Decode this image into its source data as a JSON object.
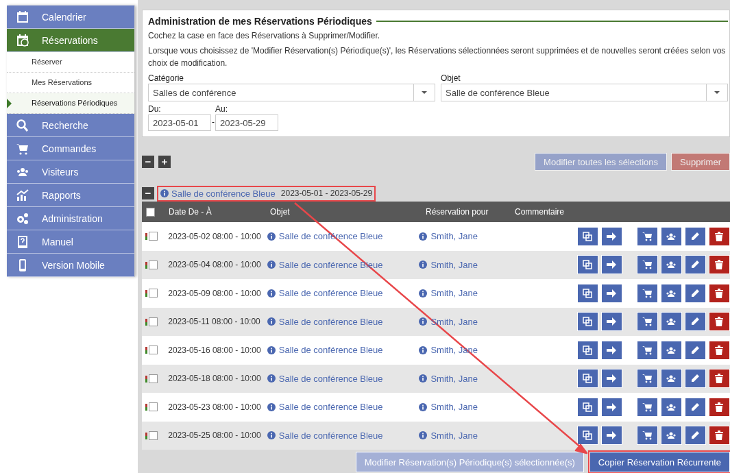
{
  "sidebar": {
    "items": [
      {
        "label": "Calendrier",
        "selected": false
      },
      {
        "label": "Réservations",
        "selected": true,
        "children": [
          {
            "label": "Réserver",
            "selected": false
          },
          {
            "label": "Mes Réservations",
            "selected": false
          },
          {
            "label": "Réservations Périodiques",
            "selected": true
          }
        ]
      },
      {
        "label": "Recherche",
        "selected": false
      },
      {
        "label": "Commandes",
        "selected": false
      },
      {
        "label": "Visiteurs",
        "selected": false
      },
      {
        "label": "Rapports",
        "selected": false
      },
      {
        "label": "Administration",
        "selected": false
      },
      {
        "label": "Manuel",
        "selected": false
      },
      {
        "label": "Version Mobile",
        "selected": false
      }
    ]
  },
  "panel": {
    "title": "Administration de mes Réservations Périodiques",
    "instructions": [
      "Cochez la case en face des Réservations à Supprimer/Modifier.",
      "Lorsque vous choisissez de 'Modifier Réservation(s) Périodique(s)', les Réservations sélectionnées seront supprimées et de nouvelles seront créées selon vos choix de modification."
    ],
    "category": {
      "label": "Catégorie",
      "value": "Salles de conférence"
    },
    "object": {
      "label": "Objet",
      "value": "Salle de conférence Bleue"
    },
    "from": {
      "label": "Du:",
      "value": "2023-05-01"
    },
    "separator": "-",
    "to": {
      "label": "Au:",
      "value": "2023-05-29"
    }
  },
  "toolbar": {
    "collapse_all": "−",
    "expand_all": "+",
    "buttons": [
      {
        "label": "Modifier toutes les sélections",
        "kind": "modify",
        "disabled": true
      },
      {
        "label": "Supprimer",
        "kind": "delete",
        "disabled": true
      }
    ]
  },
  "group": {
    "toggle": "−",
    "name": "Salle de conférence Bleue",
    "dates": "2023-05-01 - 2023-05-29",
    "highlighted": true,
    "columns": [
      "Date De - À",
      "Objet",
      "Réservation pour",
      "Commentaire"
    ],
    "select_all": {
      "checked": false
    },
    "rows": [
      {
        "date": "2023-05-02 08:00 - 10:00",
        "object": "Salle de conférence Bleue",
        "for": "Smith, Jane",
        "checked": false
      },
      {
        "date": "2023-05-04 08:00 - 10:00",
        "object": "Salle de conférence Bleue",
        "for": "Smith, Jane",
        "checked": false
      },
      {
        "date": "2023-05-09 08:00 - 10:00",
        "object": "Salle de conférence Bleue",
        "for": "Smith, Jane",
        "checked": false
      },
      {
        "date": "2023-05-11 08:00 - 10:00",
        "object": "Salle de conférence Bleue",
        "for": "Smith, Jane",
        "checked": false
      },
      {
        "date": "2023-05-16 08:00 - 10:00",
        "object": "Salle de conférence Bleue",
        "for": "Smith, Jane",
        "checked": false
      },
      {
        "date": "2023-05-18 08:00 - 10:00",
        "object": "Salle de conférence Bleue",
        "for": "Smith, Jane",
        "checked": false
      },
      {
        "date": "2023-05-23 08:00 - 10:00",
        "object": "Salle de conférence Bleue",
        "for": "Smith, Jane",
        "checked": false
      },
      {
        "date": "2023-05-25 08:00 - 10:00",
        "object": "Salle de conférence Bleue",
        "for": "Smith, Jane",
        "checked": false
      }
    ]
  },
  "footer": {
    "buttons": [
      {
        "label": "Modifier Réservation(s) Périodique(s) sélectionnée(s)",
        "disabled": true,
        "highlighted": false
      },
      {
        "label": "Copier Réservation Récurrente",
        "disabled": false,
        "highlighted": true
      }
    ]
  },
  "annotation": {
    "arrow": true
  }
}
